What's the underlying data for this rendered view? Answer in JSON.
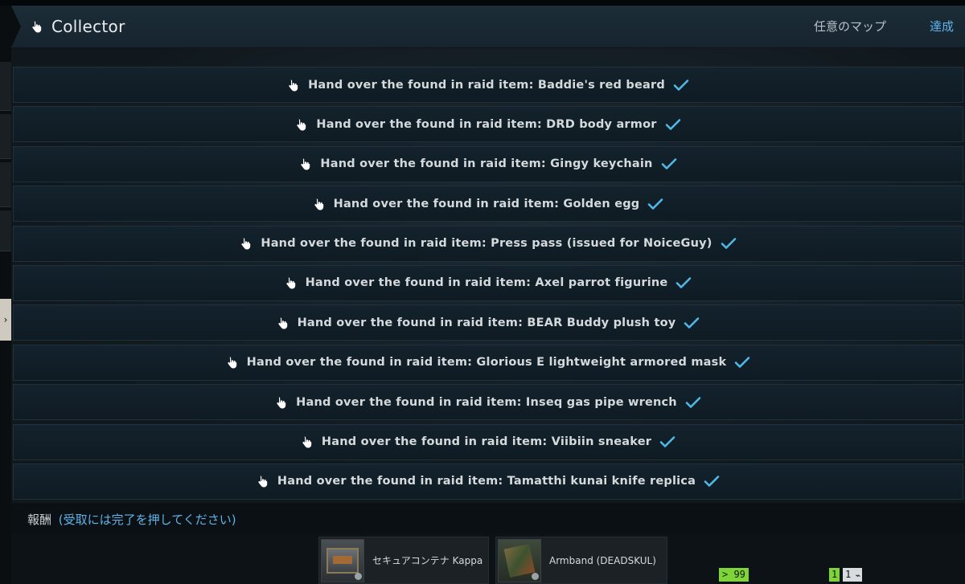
{
  "header": {
    "title": "Collector",
    "map_label": "任意のマップ",
    "status_label": "達成"
  },
  "objectives": [
    {
      "text": "Hand over the found in raid item: Baddie's red beard",
      "completed": true
    },
    {
      "text": "Hand over the found in raid item: DRD body armor",
      "completed": true
    },
    {
      "text": "Hand over the found in raid item: Gingy keychain",
      "completed": true
    },
    {
      "text": "Hand over the found in raid item: Golden egg",
      "completed": true
    },
    {
      "text": "Hand over the found in raid item: Press pass (issued for NoiceGuy)",
      "completed": true
    },
    {
      "text": "Hand over the found in raid item: Axel parrot figurine",
      "completed": true
    },
    {
      "text": "Hand over the found in raid item: BEAR Buddy plush toy",
      "completed": true
    },
    {
      "text": "Hand over the found in raid item: Glorious E lightweight armored mask",
      "completed": true
    },
    {
      "text": "Hand over the found in raid item: Inseq gas pipe wrench",
      "completed": true
    },
    {
      "text": "Hand over the found in raid item: Viibiin sneaker",
      "completed": true
    },
    {
      "text": "Hand over the found in raid item: Tamatthi kunai knife replica",
      "completed": true
    }
  ],
  "rewards": {
    "title": "報酬",
    "hint": "(受取には完了を押してください)",
    "items": [
      {
        "label": "セキュアコンテナ Kappa",
        "icon": "secure-container-icon"
      },
      {
        "label": "Armband (DEADSKUL)",
        "icon": "armband-icon"
      }
    ]
  },
  "footer": {
    "count_badge": "> 99",
    "level_badge": "1",
    "ammo_badge": "1"
  },
  "colors": {
    "accent": "#5fb3e8",
    "check": "#4fb8e6",
    "badge_green": "#7fd43a"
  }
}
